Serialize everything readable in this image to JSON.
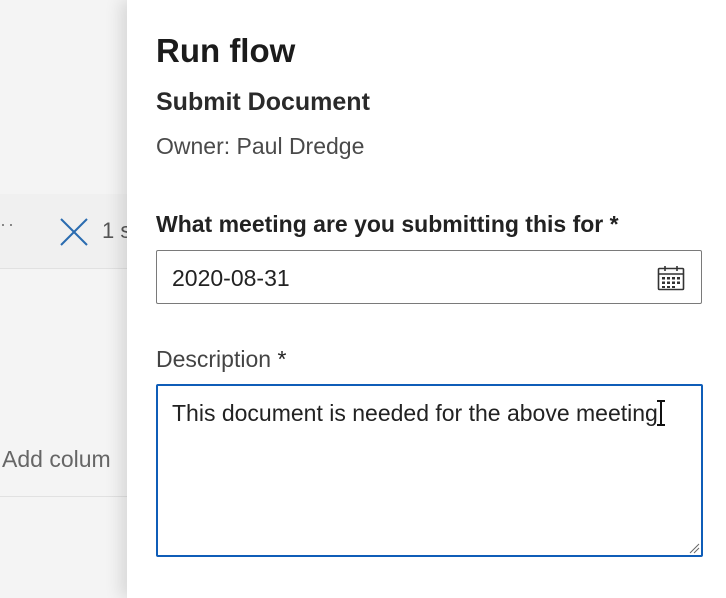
{
  "background": {
    "overflow_dots": "··",
    "selected_count": "1 s",
    "add_column": "Add colum"
  },
  "panel": {
    "title": "Run flow",
    "flow_name": "Submit Document",
    "owner": "Owner: Paul Dredge",
    "fields": {
      "meeting": {
        "label": "What meeting are you submitting this for",
        "required": "*",
        "value": "2020-08-31"
      },
      "description": {
        "label": "Description",
        "required": "*",
        "value": "This document is needed for the above meeting"
      }
    }
  },
  "colors": {
    "focus_border": "#0f5db8",
    "panel_bg": "#ffffff",
    "page_bg": "#f4f4f4"
  },
  "icons": {
    "calendar": "calendar-icon",
    "close": "close-icon",
    "cursor": "text-cursor-icon"
  }
}
